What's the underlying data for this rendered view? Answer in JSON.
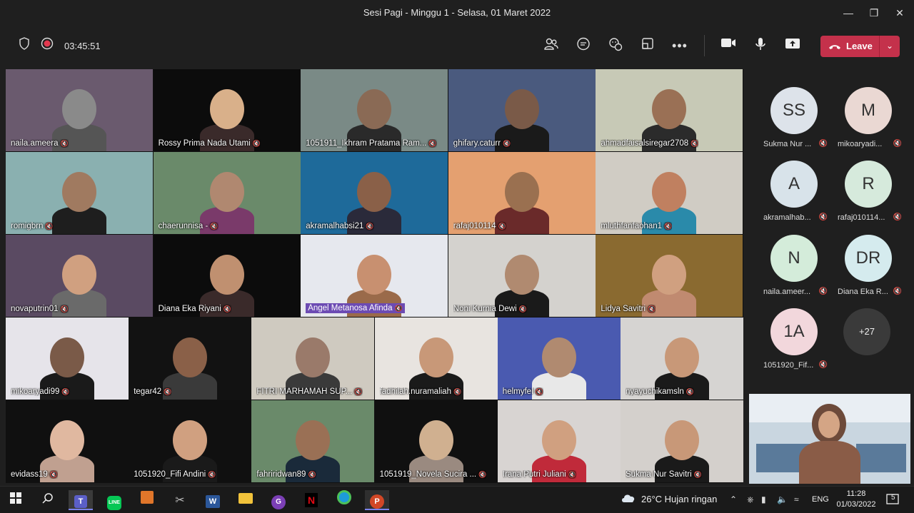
{
  "window": {
    "title": "Sesi Pagi - Minggu 1 - Selasa, 01 Maret 2022"
  },
  "toolbar": {
    "timer": "03:45:51",
    "leave_label": "Leave"
  },
  "grid": [
    {
      "name": "naila.ameera"
    },
    {
      "name": "Rossy Prima Nada Utami"
    },
    {
      "name": "1051911_Ikhram Pratama Ram..."
    },
    {
      "name": "ghifary.caturr"
    },
    {
      "name": "ahmadfaisalsiregar2708"
    },
    {
      "name": "romigbrn"
    },
    {
      "name": "chaerunnisa -"
    },
    {
      "name": "akramalhabsi21"
    },
    {
      "name": "rafaj010114"
    },
    {
      "name": "mluthfanfaohan1"
    },
    {
      "name": "novaputrin01"
    },
    {
      "name": "Diana Eka Riyani"
    },
    {
      "name": "Angel Metanosa Afinda"
    },
    {
      "name": "Noni Kurnia Dewi"
    },
    {
      "name": "Lidya Savitri"
    },
    {
      "name": "mikoaryadi99"
    },
    {
      "name": "tegar42"
    },
    {
      "name": "FITRI MARHAMAH SUP..."
    },
    {
      "name": "fadhilah.nuramaliah"
    },
    {
      "name": "helmyfel"
    },
    {
      "name": "nyayuchikamsln"
    },
    {
      "name": "evidass19"
    },
    {
      "name": "1051920_Fifi Andini"
    },
    {
      "name": "fahriridwan89"
    },
    {
      "name": "1051919_Novela Sucira ..."
    },
    {
      "name": "Irana Putri Juliani"
    },
    {
      "name": "Sukma Nur Savitri"
    }
  ],
  "roster": [
    {
      "initials": "SS",
      "name": "Sukma Nur ...",
      "color": "#dde3ea"
    },
    {
      "initials": "M",
      "name": "mikoaryadi...",
      "color": "#ead8d3"
    },
    {
      "initials": "A",
      "name": "akramalhab...",
      "color": "#d8e3ea"
    },
    {
      "initials": "R",
      "name": "rafaj010114...",
      "color": "#d6eadc"
    },
    {
      "initials": "N",
      "name": "naila.ameer...",
      "color": "#d4ecda"
    },
    {
      "initials": "DR",
      "name": "Diana Eka R...",
      "color": "#d5ebee"
    },
    {
      "initials": "1A",
      "name": "1051920_Fif...",
      "color": "#f2d7dc"
    }
  ],
  "roster_more": "+27",
  "taskbar": {
    "weather": "26°C  Hujan ringan",
    "lang": "ENG",
    "time": "11:28",
    "date": "01/03/2022",
    "notifications": "5"
  },
  "colors": {
    "leave": "#c4314b",
    "accent": "#6c4bb3"
  }
}
